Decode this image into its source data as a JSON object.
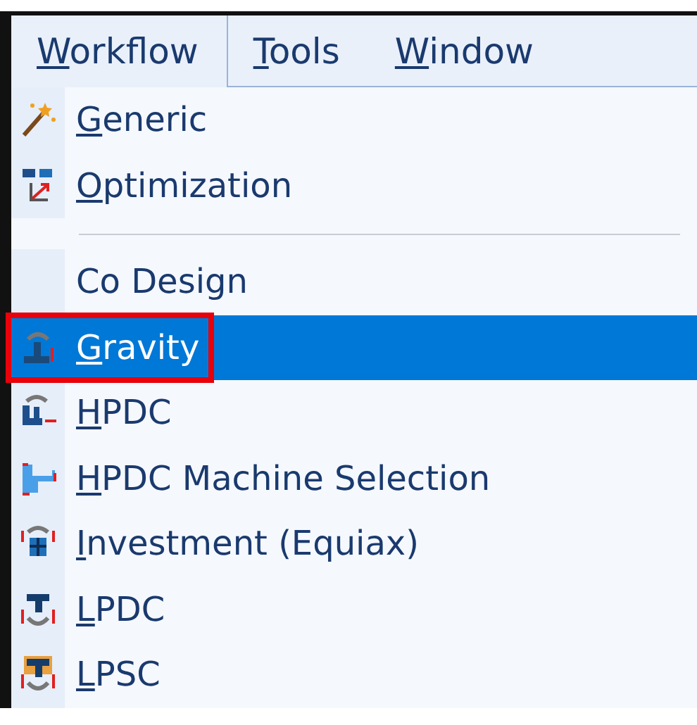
{
  "menu_bar": [
    {
      "mnemonic": "W",
      "rest": "orkflow",
      "selected": true
    },
    {
      "mnemonic": "T",
      "rest": "ools",
      "selected": false
    },
    {
      "mnemonic": "W",
      "rest": "indow",
      "selected": false
    }
  ],
  "menu": [
    {
      "kind": "item",
      "mnemonic": "G",
      "rest": "eneric",
      "selected": false,
      "highlighted": false
    },
    {
      "kind": "item",
      "mnemonic": "O",
      "rest": "ptimization",
      "selected": false,
      "highlighted": false
    },
    {
      "kind": "separator"
    },
    {
      "kind": "item",
      "rest": "Co Design",
      "selected": false,
      "highlighted": false
    },
    {
      "kind": "item",
      "mnemonic": "G",
      "rest": "ravity",
      "selected": true,
      "highlighted": true
    },
    {
      "kind": "item",
      "mnemonic": "H",
      "rest": "PDC",
      "selected": false,
      "highlighted": false
    },
    {
      "kind": "item",
      "mnemonic": "H",
      "rest": "PDC Machine Selection",
      "selected": false,
      "highlighted": false
    },
    {
      "kind": "item",
      "mnemonic": "I",
      "rest": "nvestment (Equiax)",
      "selected": false,
      "highlighted": false
    },
    {
      "kind": "item",
      "mnemonic": "L",
      "rest": "PDC",
      "selected": false,
      "highlighted": false
    },
    {
      "kind": "item",
      "mnemonic": "L",
      "rest": "PSC",
      "selected": false,
      "highlighted": false
    }
  ]
}
